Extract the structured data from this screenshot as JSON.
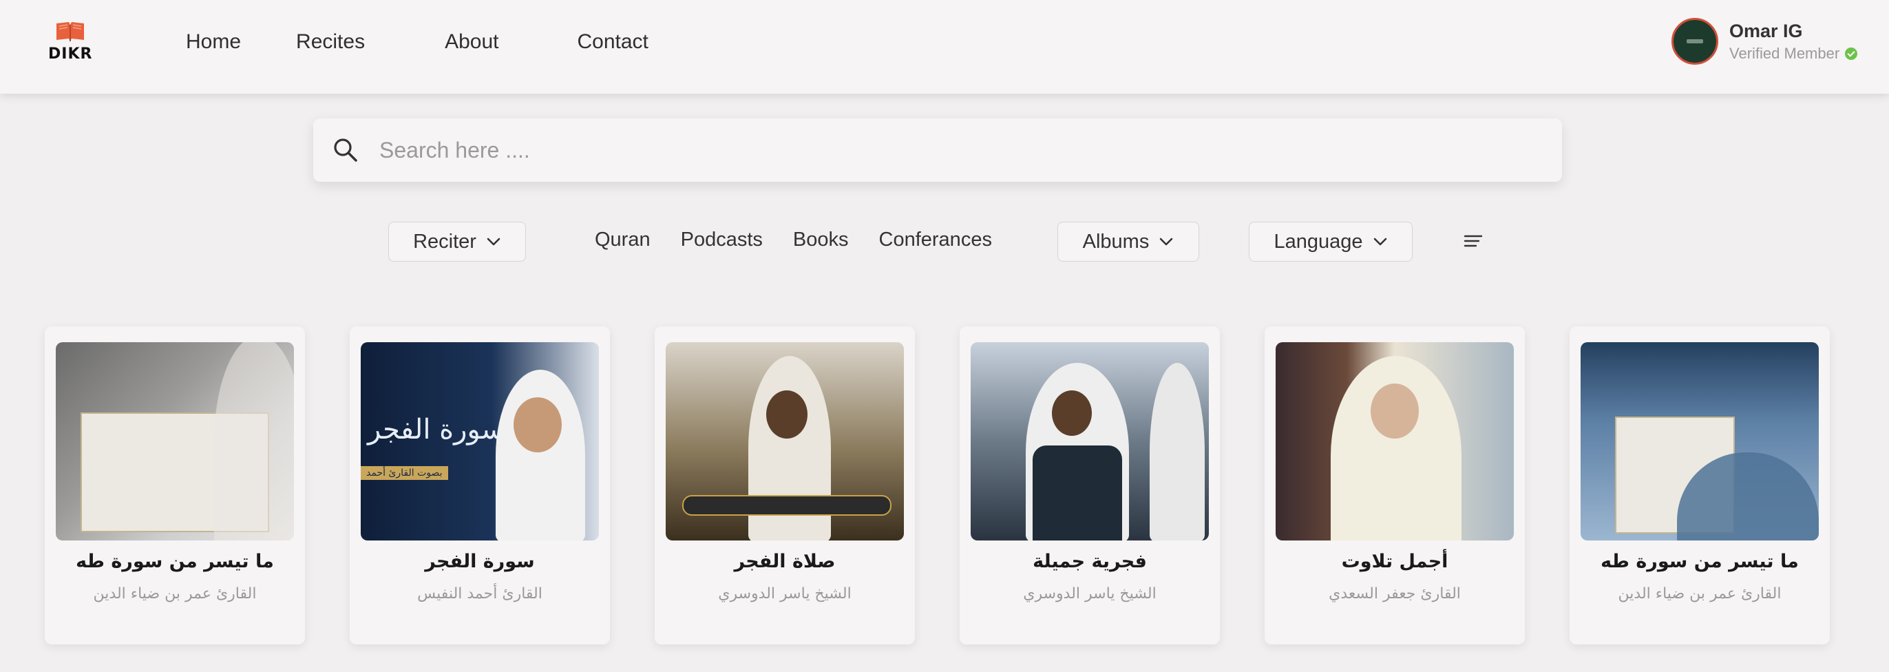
{
  "app": {
    "logo_text": "DIKR"
  },
  "nav": {
    "home": "Home",
    "recites": "Recites",
    "about": "About",
    "contact": "Contact"
  },
  "user": {
    "name": "Omar IG",
    "status": "Verified Member"
  },
  "search": {
    "placeholder": "Search here ...."
  },
  "filters": {
    "reciter": "Reciter",
    "categories": [
      "Quran",
      "Podcasts",
      "Books",
      "Conferances"
    ],
    "albums": "Albums",
    "language": "Language"
  },
  "cards": [
    {
      "title": "ما تيسر من سورة طه",
      "subtitle": "القارئ عمر بن ضياء الدين"
    },
    {
      "title": "سورة الفجر",
      "subtitle": "القارئ أحمد النفيس",
      "thumb_text": "سورة الفجر",
      "thumb_caption": "بصوت القارئ أحمد"
    },
    {
      "title": "صلاة الفجر",
      "subtitle": "الشيخ ياسر الدوسري"
    },
    {
      "title": "فجرية جميلة",
      "subtitle": "الشيخ ياسر الدوسري"
    },
    {
      "title": "أجمل تلاوت",
      "subtitle": "القارئ جعفر السعدي"
    },
    {
      "title": "ما تيسر من سورة طه",
      "subtitle": "القارئ عمر بن ضياء الدين"
    }
  ],
  "colors": {
    "accent": "#e8613c",
    "verified": "#6cc24a",
    "background": "#f1efef"
  },
  "icons": [
    "book-logo-icon",
    "search-icon",
    "chevron-down-icon",
    "sort-icon",
    "verified-check-icon"
  ]
}
